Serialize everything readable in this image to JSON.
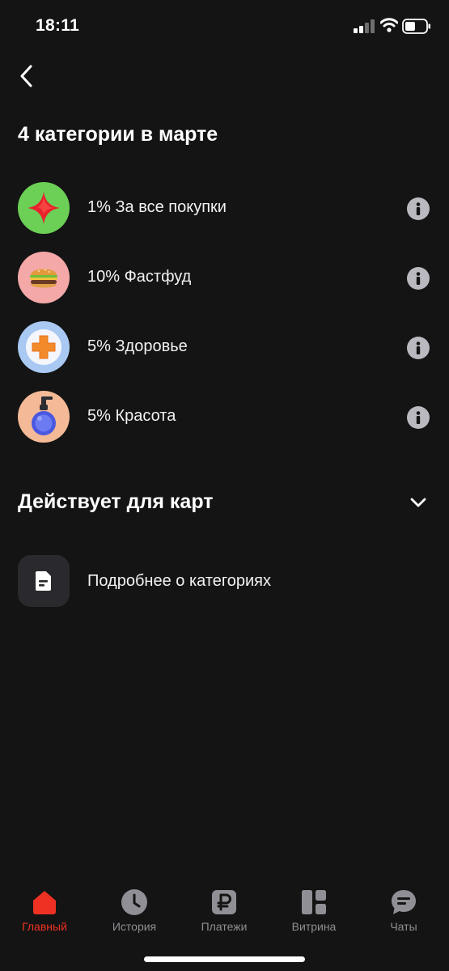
{
  "status_bar": {
    "time": "18:11"
  },
  "title": "4 категории в марте",
  "categories": [
    {
      "label": "1% За все покупки",
      "icon": "red-star-icon"
    },
    {
      "label": "10% Фастфуд",
      "icon": "burger-icon"
    },
    {
      "label": "5% Здоровье",
      "icon": "medical-cross-icon"
    },
    {
      "label": "5% Красота",
      "icon": "perfume-bottle-icon"
    }
  ],
  "cards_section": {
    "title": "Действует для карт"
  },
  "details": {
    "label": "Подробнее о категориях"
  },
  "tabs": [
    {
      "label": "Главный",
      "icon": "home-icon",
      "active": true
    },
    {
      "label": "История",
      "icon": "clock-icon",
      "active": false
    },
    {
      "label": "Платежи",
      "icon": "ruble-icon",
      "active": false
    },
    {
      "label": "Витрина",
      "icon": "grid-icon",
      "active": false
    },
    {
      "label": "Чаты",
      "icon": "chat-bubble-icon",
      "active": false
    }
  ],
  "colors": {
    "background": "#141414",
    "accent": "#ef3124",
    "inactive_tab": "#8f8f95",
    "info_icon": "#b9b9bf"
  }
}
